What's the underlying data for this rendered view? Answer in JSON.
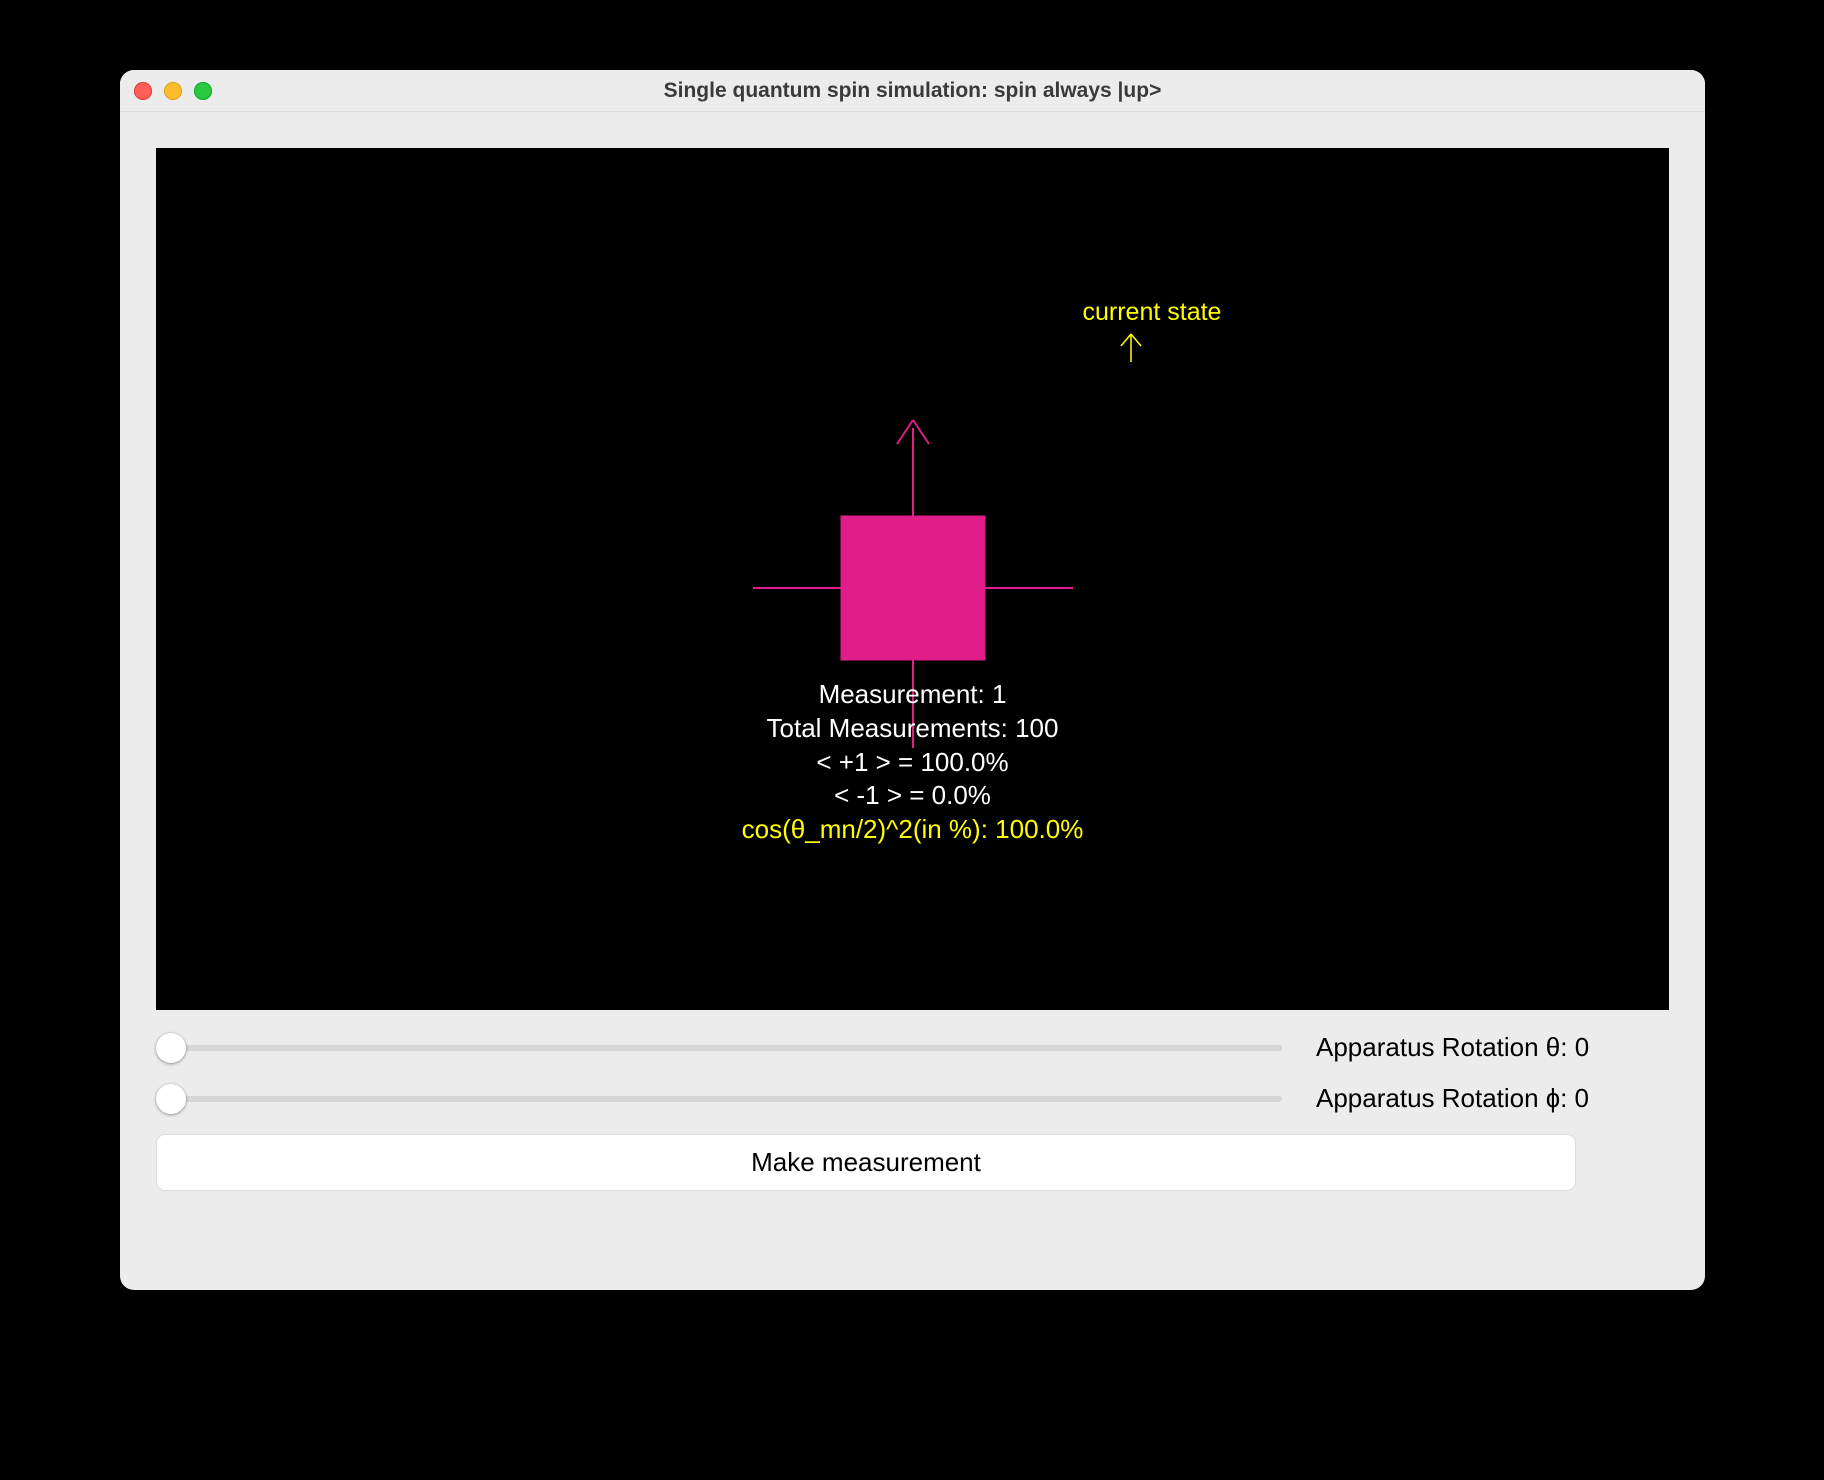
{
  "window": {
    "title": "Single quantum spin simulation: spin always |up>"
  },
  "canvas": {
    "current_state_label": "current state",
    "measurement_line": "Measurement: 1",
    "total_line": "Total Measurements: 100",
    "plus_line": "< +1 > = 100.0%",
    "minus_line": "< -1 > = 0.0%",
    "theory_line": "cos(θ_mn/2)^2(in %): 100.0%"
  },
  "controls": {
    "theta_label": "Apparatus Rotation θ: 0",
    "phi_label": "Apparatus Rotation ɸ: 0",
    "measure_button": "Make measurement"
  },
  "colors": {
    "magenta": "#e01d88",
    "yellow": "#ffff00"
  }
}
